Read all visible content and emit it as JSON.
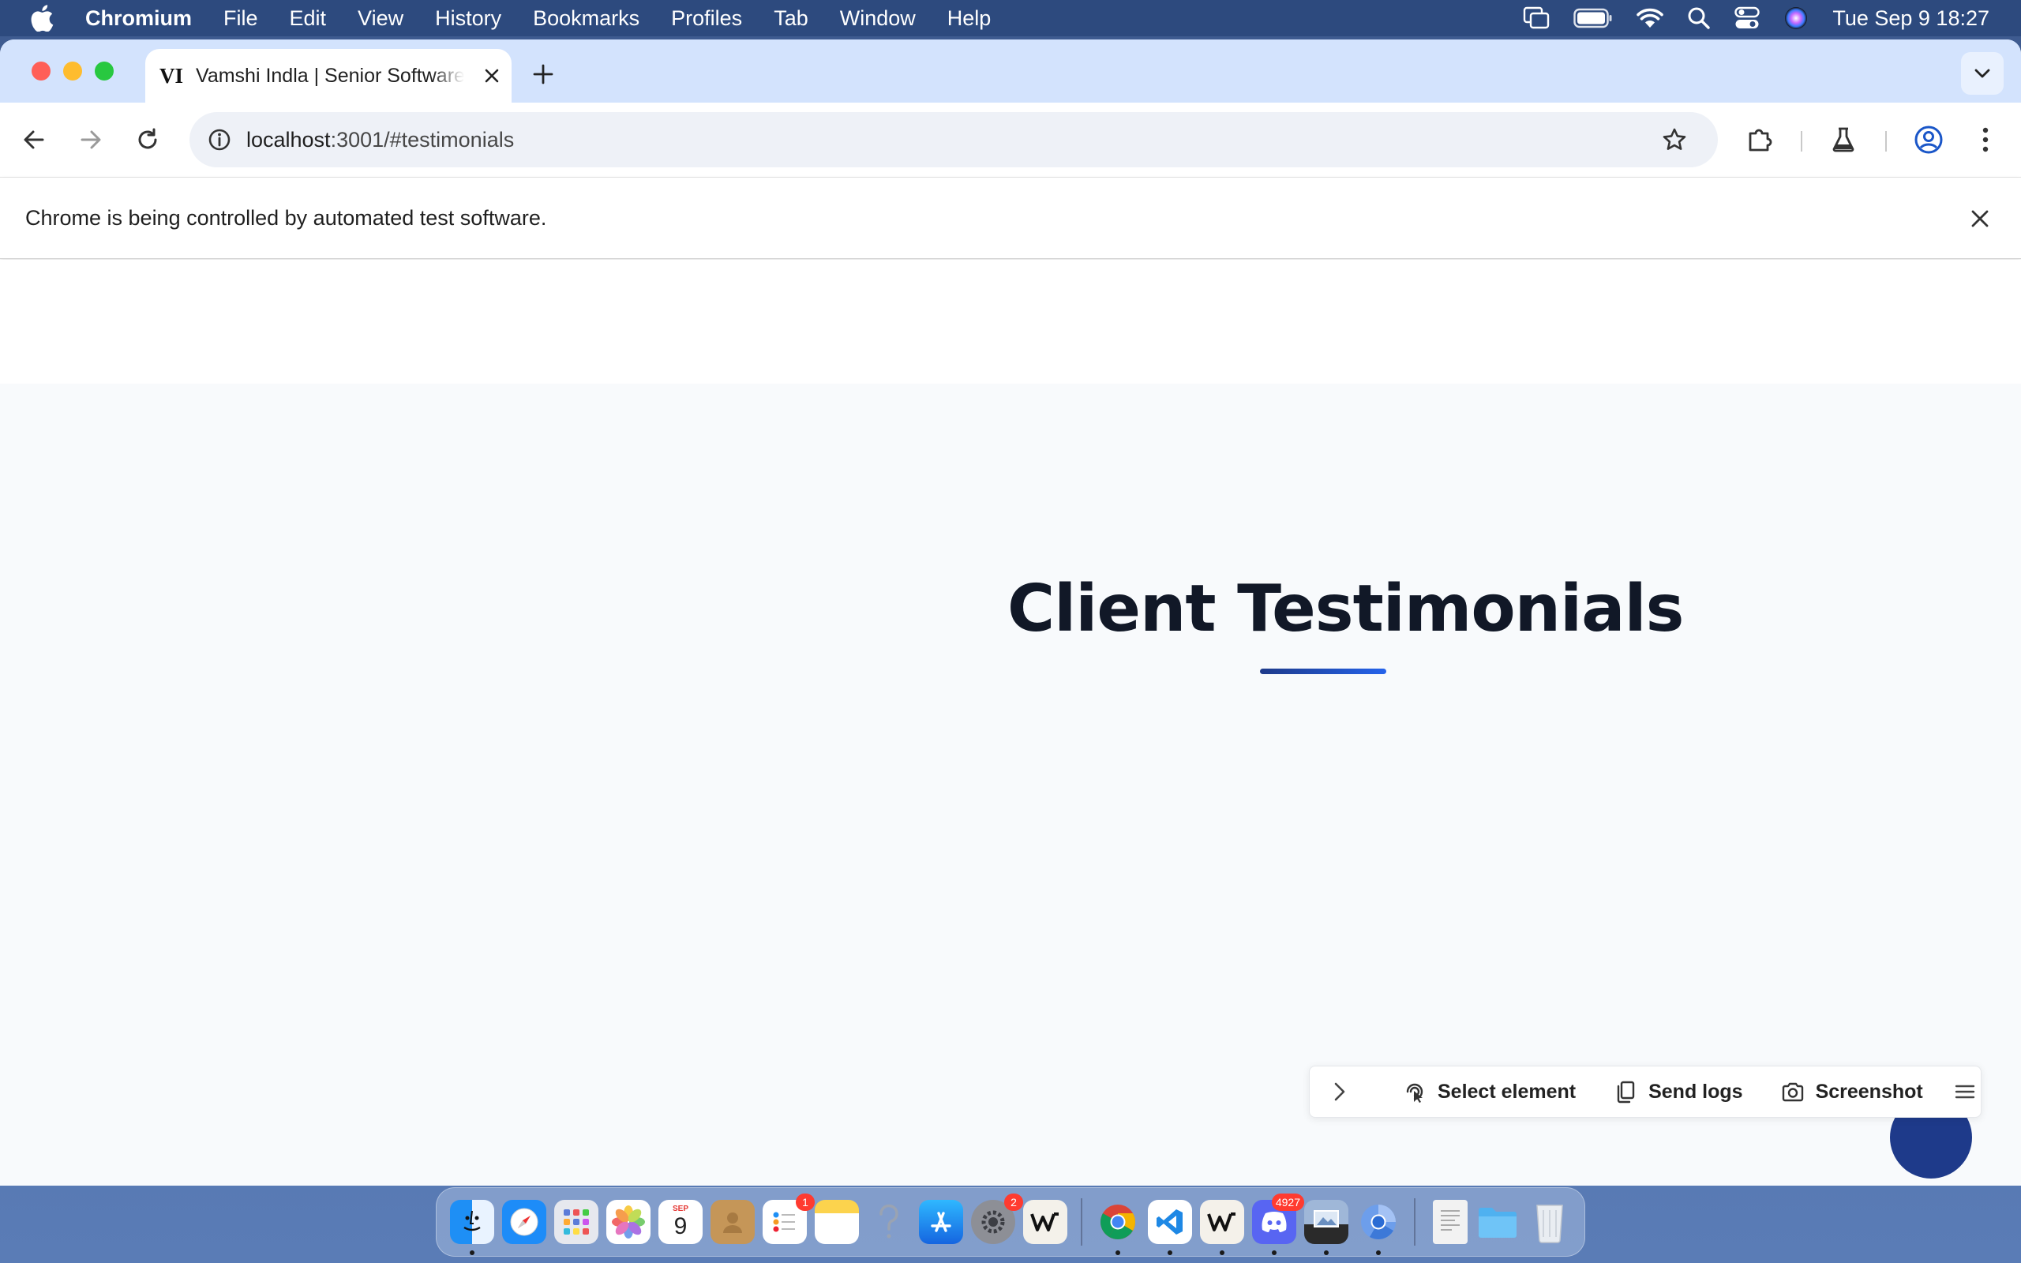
{
  "menubar": {
    "app_name": "Chromium",
    "menus": [
      "File",
      "Edit",
      "View",
      "History",
      "Bookmarks",
      "Profiles",
      "Tab",
      "Window",
      "Help"
    ],
    "clock": "Tue Sep 9  18:27",
    "status_icons": [
      "screen-mirroring-icon",
      "battery-icon",
      "wifi-icon",
      "spotlight-icon",
      "control-center-icon",
      "siri-icon"
    ]
  },
  "browser": {
    "tab": {
      "favicon": "VI",
      "title": "Vamshi Indla | Senior Software Engineer"
    },
    "address": {
      "host": "localhost",
      "path": ":3001/#testimonials"
    },
    "infobar": {
      "message": "Chrome is being controlled by automated test software."
    }
  },
  "page": {
    "heading": "Client Testimonials",
    "accent_color": "#1e3a8a",
    "devtools_bar": {
      "select_element": "Select element",
      "send_logs": "Send logs",
      "screenshot": "Screenshot"
    }
  },
  "dock": {
    "calendar": {
      "month": "SEP",
      "day": "9"
    },
    "badges": {
      "reminders": "1",
      "settings": "2",
      "discord": "4927"
    },
    "apps": [
      "finder",
      "safari",
      "launchpad",
      "photos",
      "calendar",
      "contacts",
      "reminders",
      "notes",
      "help",
      "app-store",
      "system-settings",
      "warp",
      "chrome",
      "vscode",
      "warp",
      "discord",
      "preview",
      "chromium",
      "document",
      "folder",
      "trash"
    ]
  }
}
